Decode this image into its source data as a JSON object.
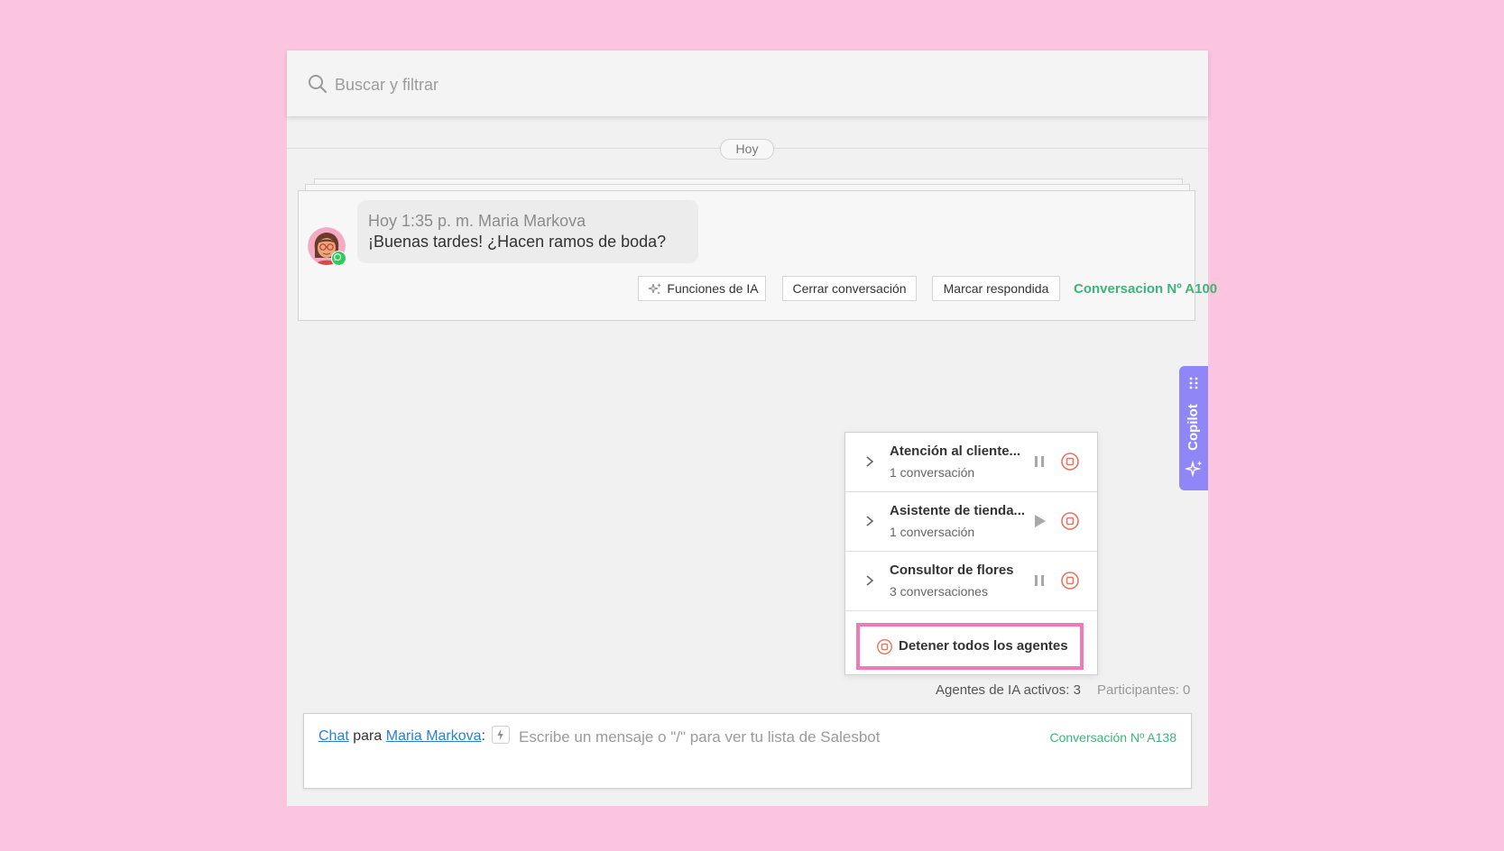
{
  "search": {
    "placeholder": "Buscar y filtrar"
  },
  "feed": {
    "date_label": "Hoy",
    "message": {
      "meta": "Hoy 1:35 p. m. Maria Markova",
      "text": "¡Buenas tardes! ¿Hacen ramos de boda?"
    },
    "actions": {
      "ai_label": "Funciones de IA",
      "close_label": "Cerrar conversación",
      "mark_label": "Marcar respondida"
    },
    "conversation_link": "Conversacion Nº A100"
  },
  "copilot": {
    "label": "Copilot"
  },
  "agents": {
    "items": [
      {
        "name": "Atención al cliente...",
        "count": "1 conversación",
        "state": "running"
      },
      {
        "name": "Asistente de tienda...",
        "count": "1 conversación",
        "state": "paused"
      },
      {
        "name": "Consultor de flores",
        "count": "3 conversaciones",
        "state": "running"
      }
    ],
    "stop_all_label": "Detener todos los agentes",
    "active_label": "Agentes de IA activos: 3",
    "participants_label": "Participantes: 0"
  },
  "composer": {
    "channel_label": "Chat",
    "for_label": "para",
    "recipient_label": "Maria Markova",
    "colon": ":",
    "placeholder": "Escribe un mensaje o \"/\" para ver tu lista de Salesbot",
    "conversation_label": "Conversación Nº A138"
  },
  "colors": {
    "background": "#fcc5df",
    "accent_green": "#3fb27a",
    "link_blue": "#2a7fdb",
    "copilot_purple": "#8f87f7",
    "stop_red": "#e8735e",
    "highlight_pink": "#f07ab8"
  }
}
